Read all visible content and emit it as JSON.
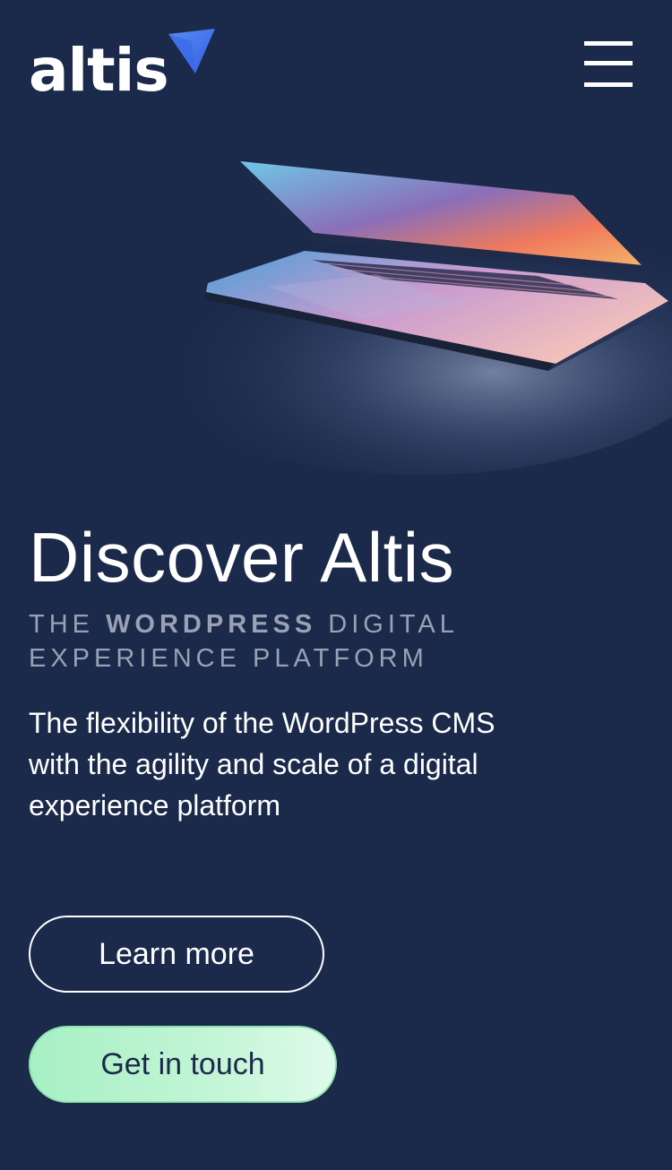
{
  "header": {
    "logo_text": "altis",
    "logo_icon": "altis-arrow-icon",
    "menu_icon": "hamburger-menu-icon"
  },
  "hero": {
    "image": "laptop-illustration",
    "title": "Discover Altis",
    "subtitle_prefix": "The ",
    "subtitle_bold": "WordPress",
    "subtitle_suffix": " digital experience platform",
    "description": "The flexibility of the WordPress CMS with the agility and scale of a digital experience platform"
  },
  "actions": {
    "learn_more": "Learn more",
    "get_in_touch": "Get in touch"
  },
  "colors": {
    "background": "#1b2a4a",
    "accent": "#4a7cf0",
    "cta": "#a7f0c4"
  }
}
